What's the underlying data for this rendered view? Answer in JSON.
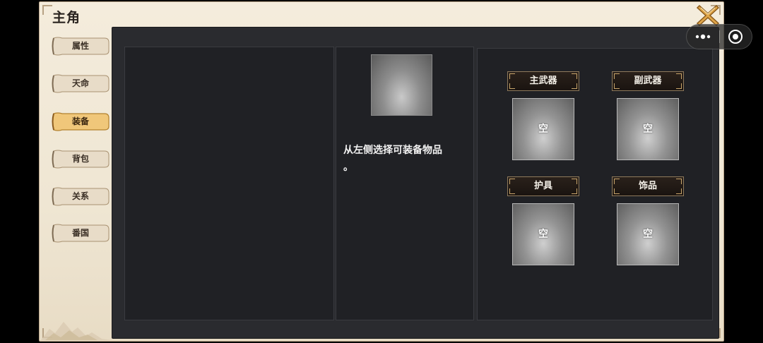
{
  "window": {
    "title": "主角"
  },
  "tabs": [
    {
      "label": "属性",
      "active": false
    },
    {
      "label": "天命",
      "active": false
    },
    {
      "label": "装备",
      "active": true
    },
    {
      "label": "背包",
      "active": false
    },
    {
      "label": "关系",
      "active": false
    },
    {
      "label": "番国",
      "active": false
    }
  ],
  "detail": {
    "hint": "从左侧选择可装备物品",
    "hint_end": "。"
  },
  "slots": [
    {
      "label": "主武器",
      "value": "空"
    },
    {
      "label": "副武器",
      "value": "空"
    },
    {
      "label": "护具",
      "value": "空"
    },
    {
      "label": "饰品",
      "value": "空"
    }
  ],
  "icons": {
    "close": "close-x-icon",
    "more": "more-dots-icon",
    "target": "target-icon"
  },
  "colors": {
    "parchment": "#f4ecdc",
    "panel": "#2a2b2f",
    "tab_active": "#f0c77a",
    "label_bg": "#1a1410"
  }
}
